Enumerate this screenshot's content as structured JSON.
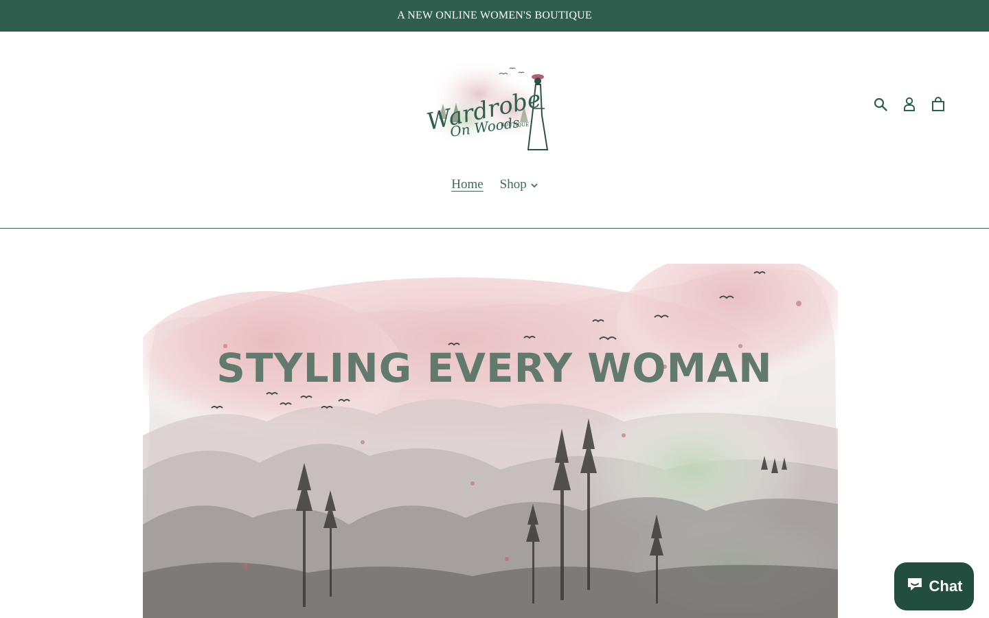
{
  "announcement": {
    "text": "A NEW ONLINE WOMEN'S BOUTIQUE"
  },
  "logo": {
    "line1": "Wardrobe",
    "line2": "On Woods",
    "tag": "BOUTIQUE"
  },
  "header_icons": [
    {
      "name": "search-icon"
    },
    {
      "name": "account-icon"
    },
    {
      "name": "cart-icon"
    }
  ],
  "nav": {
    "items": [
      {
        "label": "Home",
        "active": true
      },
      {
        "label": "Shop",
        "dropdown": true
      }
    ]
  },
  "hero": {
    "title": "STYLING EVERY WOMAN"
  },
  "chat": {
    "label": "Chat"
  },
  "colors": {
    "brand_green": "#2e5e4e",
    "nav_text": "#3f6a5b",
    "hero_title": "#627a6e",
    "chat_bg": "#214e3f"
  }
}
